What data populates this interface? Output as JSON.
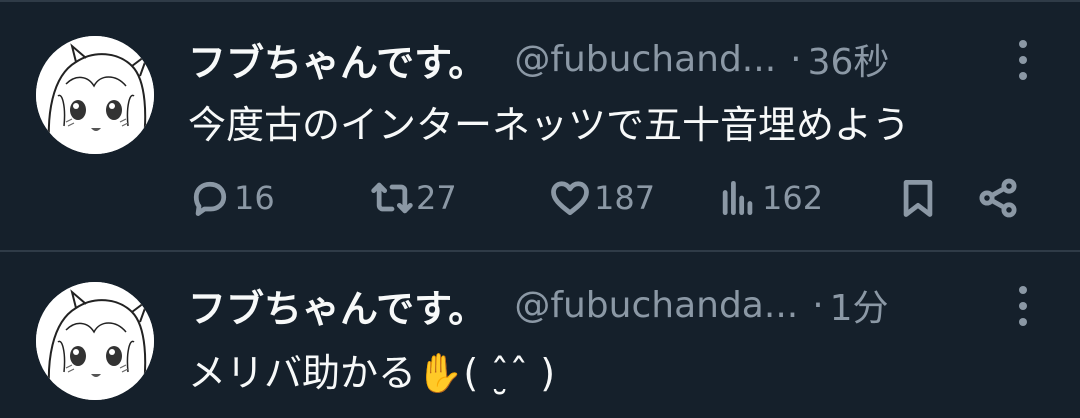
{
  "tweets": [
    {
      "display_name": "フブちゃんです。",
      "handle": "@fubuchand...",
      "separator": "·",
      "time": "36秒",
      "text": "今度古のインターネッツで五十音埋めよう",
      "avatar_icon": "avatar-image",
      "actions": {
        "reply_count": "16",
        "retweet_count": "27",
        "like_count": "187",
        "view_count": "162"
      }
    },
    {
      "display_name": "フブちゃんです。",
      "handle": "@fubuchanda...",
      "separator": "·",
      "time": "1分",
      "text": "メリバ助かる✋( ˆ̮ˆ )",
      "avatar_icon": "avatar-image"
    }
  ],
  "colors": {
    "background": "#15202b",
    "divider": "#2f3b47",
    "primary_text": "#f7f9f9",
    "secondary_text": "#8b98a5"
  }
}
